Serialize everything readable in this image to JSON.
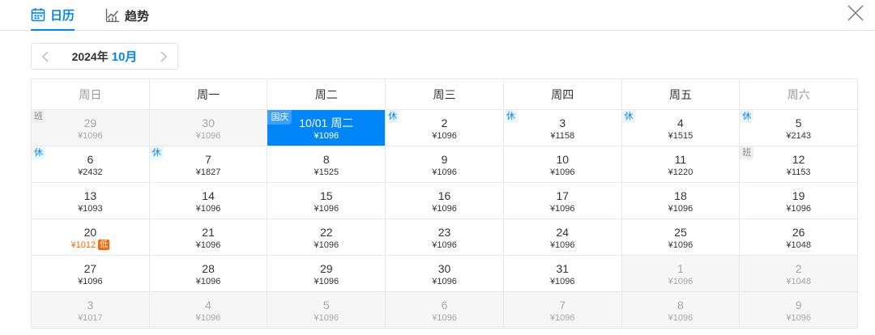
{
  "tabs": [
    {
      "label": "日历",
      "icon": "calendar-icon"
    },
    {
      "label": "趋势",
      "icon": "trend-chart-icon"
    }
  ],
  "month_nav": {
    "year": "2024年",
    "month": "10月"
  },
  "weekdays": [
    "周日",
    "周一",
    "周二",
    "周三",
    "周四",
    "周五",
    "周六"
  ],
  "colors": {
    "accent": "#0086f6",
    "low_price": "#ff6600"
  },
  "weeks": [
    [
      {
        "day": "29",
        "price": "¥1096",
        "tag": "班",
        "outside": true
      },
      {
        "day": "30",
        "price": "¥1096",
        "outside": true
      },
      {
        "day": "10/01",
        "weekday": "周二",
        "price": "¥1096",
        "tag": "国庆",
        "selected": true
      },
      {
        "day": "2",
        "price": "¥1096",
        "tag": "休"
      },
      {
        "day": "3",
        "price": "¥1158",
        "tag": "休"
      },
      {
        "day": "4",
        "price": "¥1515",
        "tag": "休"
      },
      {
        "day": "5",
        "price": "¥2143",
        "tag": "休"
      }
    ],
    [
      {
        "day": "6",
        "price": "¥2432",
        "tag": "休"
      },
      {
        "day": "7",
        "price": "¥1827",
        "tag": "休"
      },
      {
        "day": "8",
        "price": "¥1525"
      },
      {
        "day": "9",
        "price": "¥1096"
      },
      {
        "day": "10",
        "price": "¥1096"
      },
      {
        "day": "11",
        "price": "¥1220"
      },
      {
        "day": "12",
        "price": "¥1153",
        "tag": "班"
      }
    ],
    [
      {
        "day": "13",
        "price": "¥1093"
      },
      {
        "day": "14",
        "price": "¥1096"
      },
      {
        "day": "15",
        "price": "¥1096"
      },
      {
        "day": "16",
        "price": "¥1096"
      },
      {
        "day": "17",
        "price": "¥1096"
      },
      {
        "day": "18",
        "price": "¥1096"
      },
      {
        "day": "19",
        "price": "¥1096"
      }
    ],
    [
      {
        "day": "20",
        "price": "¥1012",
        "low": "低"
      },
      {
        "day": "21",
        "price": "¥1096"
      },
      {
        "day": "22",
        "price": "¥1096"
      },
      {
        "day": "23",
        "price": "¥1096"
      },
      {
        "day": "24",
        "price": "¥1096"
      },
      {
        "day": "25",
        "price": "¥1096"
      },
      {
        "day": "26",
        "price": "¥1048"
      }
    ],
    [
      {
        "day": "27",
        "price": "¥1096"
      },
      {
        "day": "28",
        "price": "¥1096"
      },
      {
        "day": "29",
        "price": "¥1096"
      },
      {
        "day": "30",
        "price": "¥1096"
      },
      {
        "day": "31",
        "price": "¥1096"
      },
      {
        "day": "1",
        "price": "¥1096",
        "outside": true
      },
      {
        "day": "2",
        "price": "¥1048",
        "outside": true
      }
    ],
    [
      {
        "day": "3",
        "price": "¥1017",
        "outside": true
      },
      {
        "day": "4",
        "price": "¥1096",
        "outside": true
      },
      {
        "day": "5",
        "price": "¥1096",
        "outside": true
      },
      {
        "day": "6",
        "price": "¥1096",
        "outside": true
      },
      {
        "day": "7",
        "price": "¥1096",
        "outside": true
      },
      {
        "day": "8",
        "price": "¥1096",
        "outside": true
      },
      {
        "day": "9",
        "price": "¥1096",
        "outside": true
      }
    ]
  ]
}
